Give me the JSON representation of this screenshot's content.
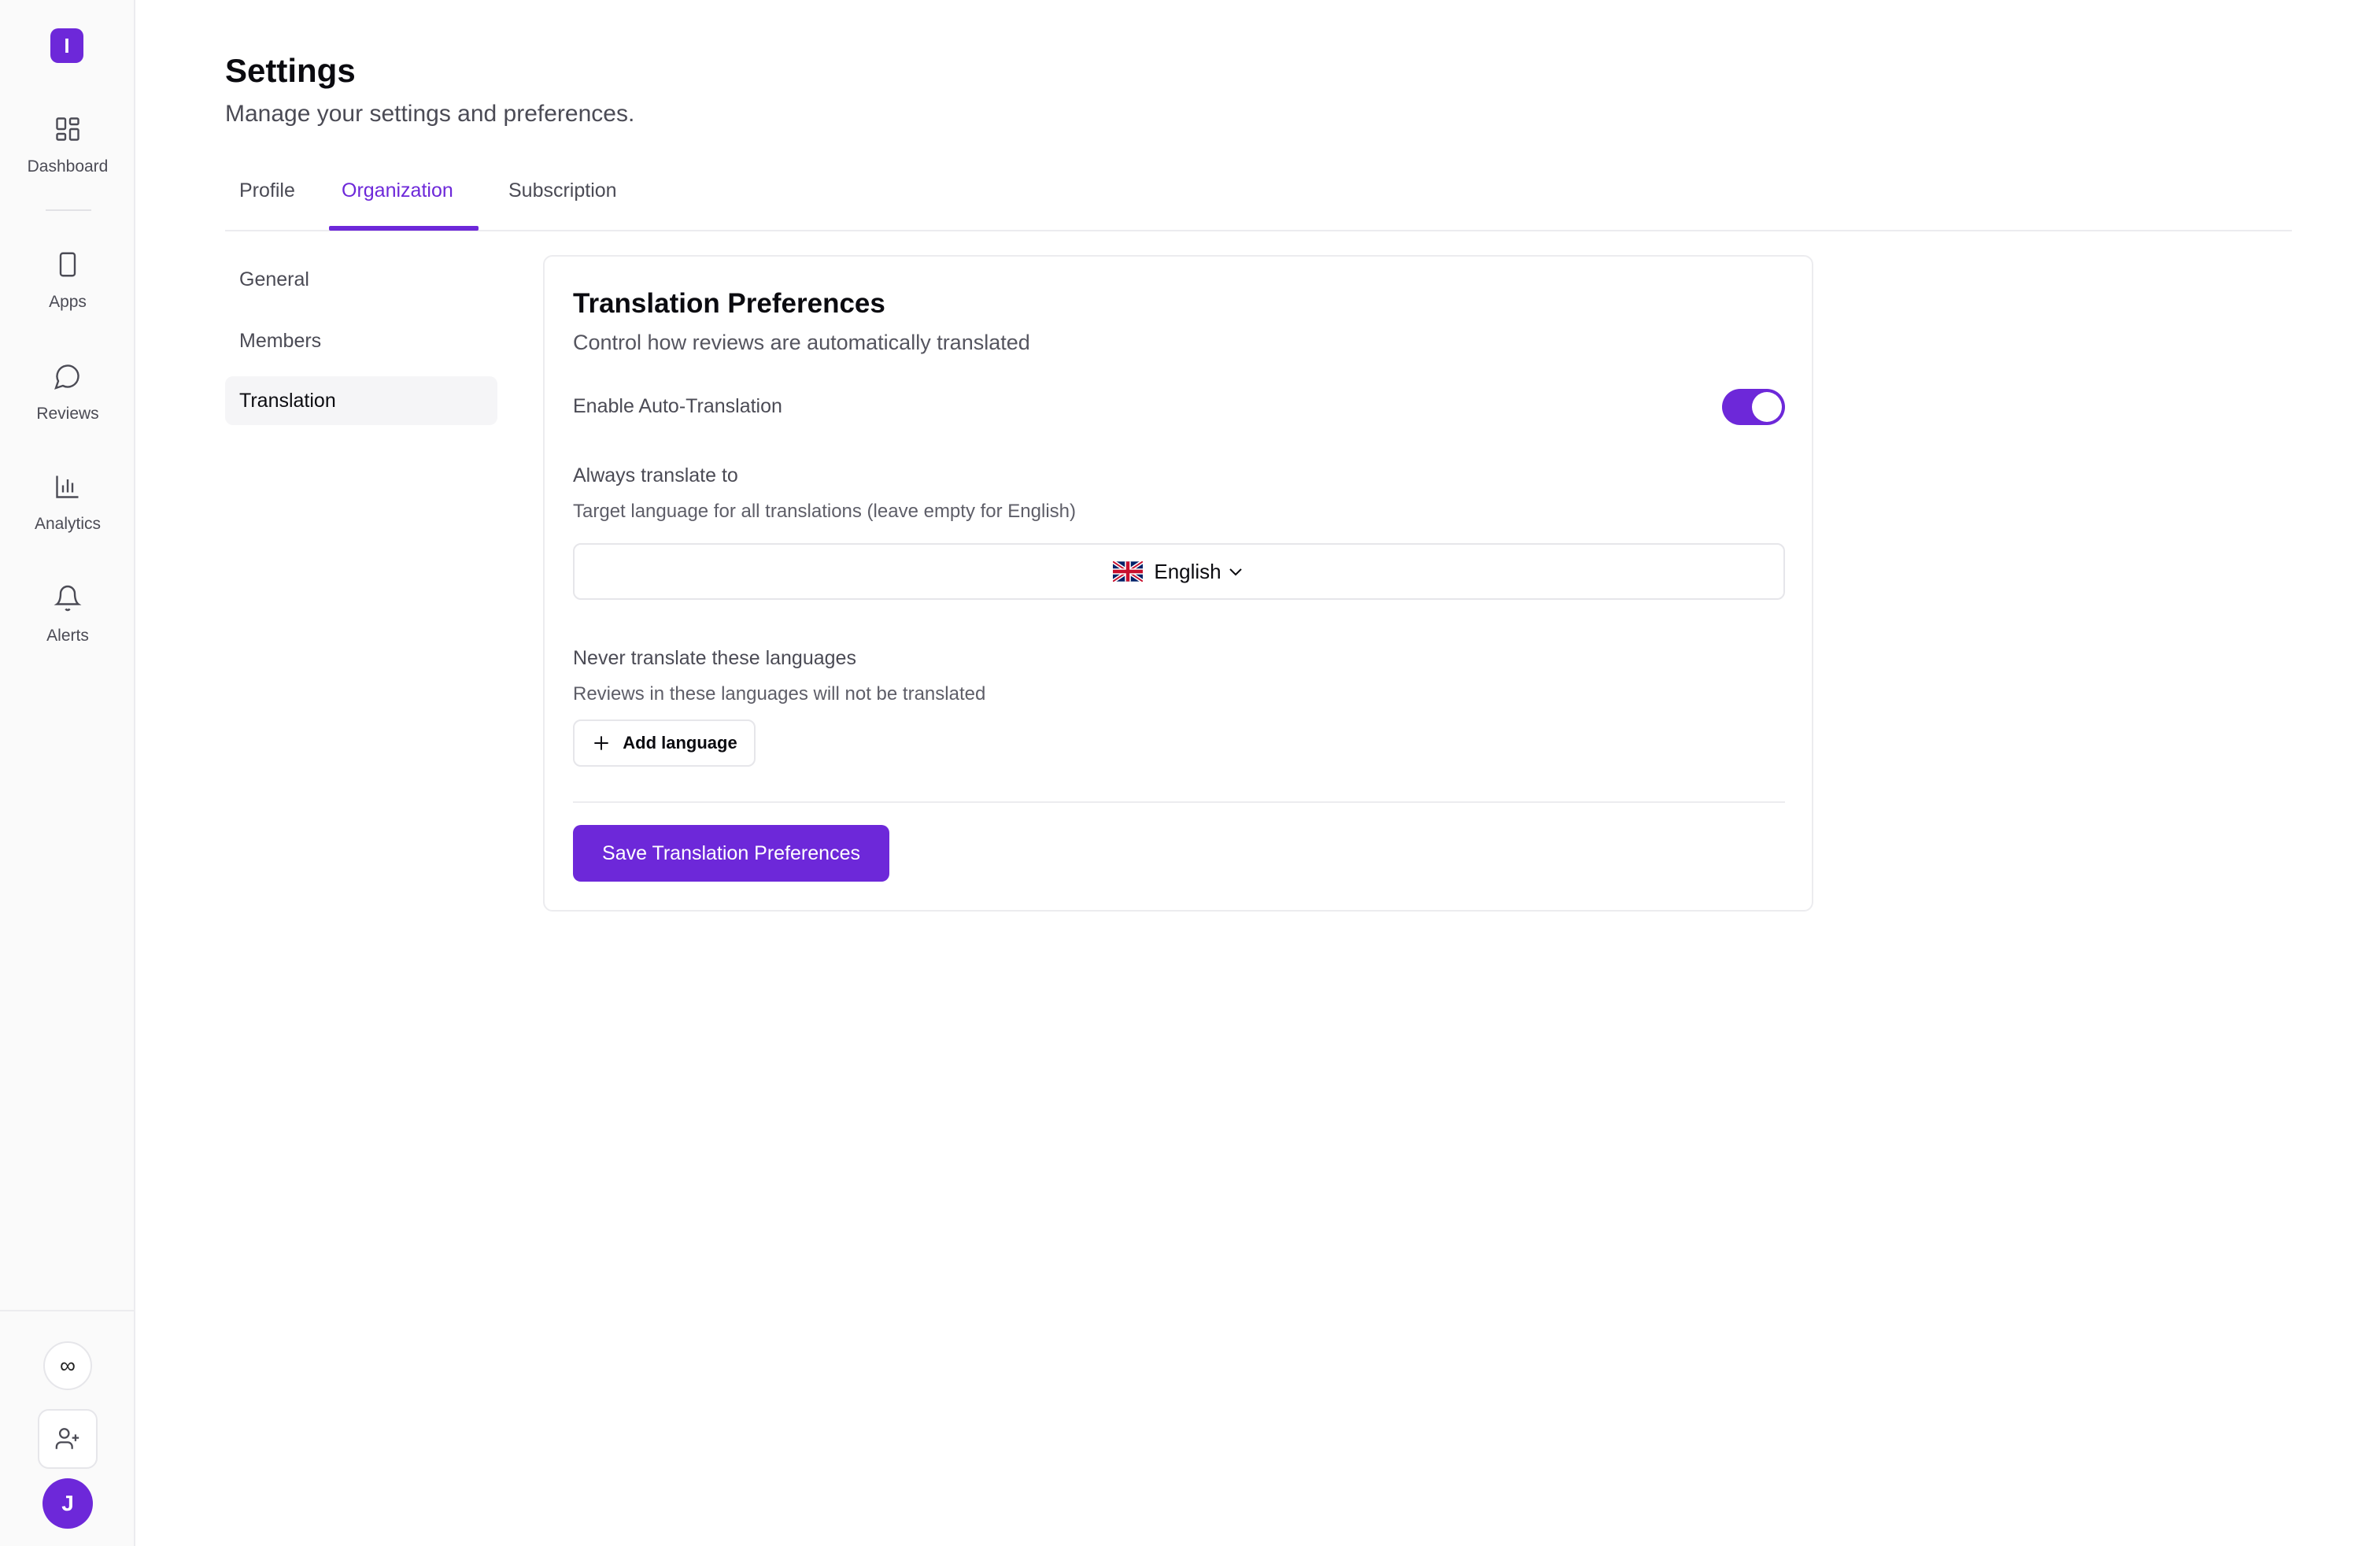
{
  "sidebar": {
    "logo_letter": "I",
    "items": [
      {
        "label": "Dashboard",
        "icon": "dashboard-icon"
      },
      {
        "label": "Apps",
        "icon": "phone-icon"
      },
      {
        "label": "Reviews",
        "icon": "chat-bubble-icon"
      },
      {
        "label": "Analytics",
        "icon": "bar-chart-icon"
      },
      {
        "label": "Alerts",
        "icon": "bell-icon"
      }
    ],
    "infinity_symbol": "∞",
    "avatar_initial": "J"
  },
  "header": {
    "title": "Settings",
    "subtitle": "Manage your settings and preferences."
  },
  "tabs": [
    {
      "label": "Profile",
      "active": false
    },
    {
      "label": "Organization",
      "active": true
    },
    {
      "label": "Subscription",
      "active": false
    }
  ],
  "subnav": [
    {
      "label": "General",
      "active": false
    },
    {
      "label": "Members",
      "active": false
    },
    {
      "label": "Translation",
      "active": true
    }
  ],
  "card": {
    "title": "Translation Preferences",
    "description": "Control how reviews are automatically translated",
    "auto_translation": {
      "label": "Enable Auto-Translation",
      "enabled": true
    },
    "target": {
      "label": "Always translate to",
      "help": "Target language for all translations (leave empty for English)",
      "selected": "English"
    },
    "never": {
      "label": "Never translate these languages",
      "help": "Reviews in these languages will not be translated",
      "add_label": "Add language"
    },
    "save_label": "Save Translation Preferences"
  },
  "colors": {
    "accent": "#6d28d9",
    "sidebar_bg": "#fafafa",
    "border": "#ececef",
    "muted_text": "#4b4b55"
  }
}
